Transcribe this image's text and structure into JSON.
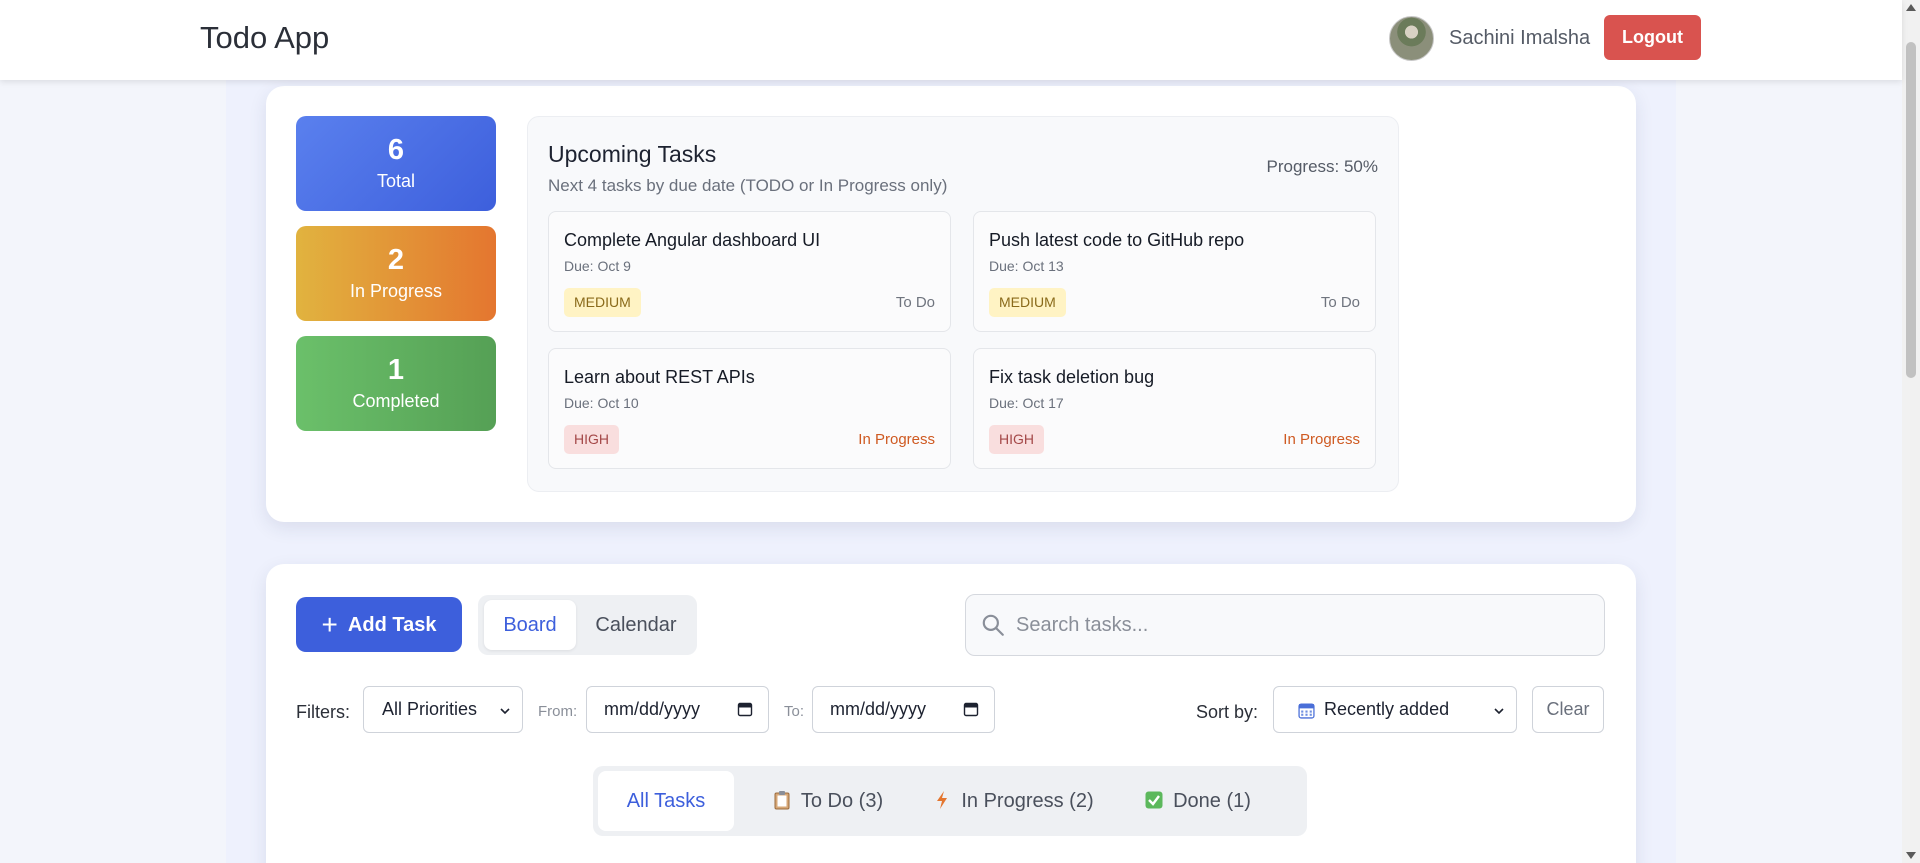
{
  "header": {
    "title": "Todo App",
    "user_name": "Sachini Imalsha",
    "logout_label": "Logout"
  },
  "stats": {
    "total": {
      "value": "6",
      "label": "Total"
    },
    "in_progress": {
      "value": "2",
      "label": "In Progress"
    },
    "completed": {
      "value": "1",
      "label": "Completed"
    }
  },
  "upcoming": {
    "title": "Upcoming Tasks",
    "subtitle": "Next 4 tasks by due date (TODO or In Progress only)",
    "progress": "Progress: 50%",
    "tasks": [
      {
        "title": "Complete Angular dashboard UI",
        "due": "Due: Oct 9",
        "priority": "MEDIUM",
        "status": "To Do"
      },
      {
        "title": "Push latest code to GitHub repo",
        "due": "Due: Oct 13",
        "priority": "MEDIUM",
        "status": "To Do"
      },
      {
        "title": "Learn about REST APIs",
        "due": "Due: Oct 10",
        "priority": "HIGH",
        "status": "In Progress"
      },
      {
        "title": "Fix task deletion bug",
        "due": "Due: Oct 17",
        "priority": "HIGH",
        "status": "In Progress"
      }
    ]
  },
  "toolbar": {
    "add_task_label": "Add Task",
    "view_board": "Board",
    "view_calendar": "Calendar",
    "search_placeholder": "Search tasks..."
  },
  "filters": {
    "label": "Filters:",
    "priority_value": "All Priorities",
    "from_label": "From:",
    "to_label": "To:",
    "from_value": "mm/dd/yyyy",
    "to_value": "mm/dd/yyyy",
    "sort_label": "Sort by:",
    "sort_value": "Recently added",
    "clear_label": "Clear"
  },
  "tabs": {
    "all": "All Tasks",
    "todo": "To Do (3)",
    "in_progress": "In Progress (2)",
    "done": "Done (1)"
  },
  "colors": {
    "accent": "#3d5fdc",
    "logout": "#d9534f",
    "in_progress_status": "#cf5a22"
  },
  "icons": [
    "search-icon",
    "plus-icon",
    "calendar-icon",
    "clipboard-icon",
    "lightning-icon",
    "checkmark-icon",
    "chevron-down-icon"
  ]
}
